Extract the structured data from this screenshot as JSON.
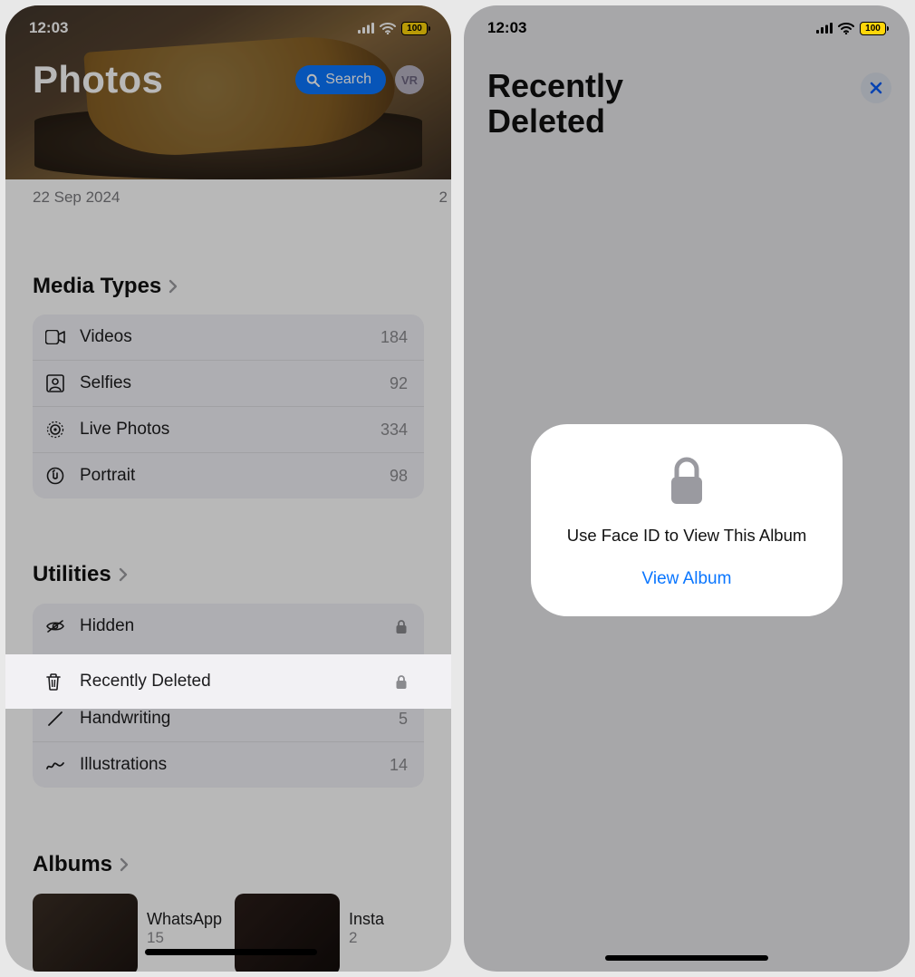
{
  "status": {
    "time": "12:03",
    "battery": "100"
  },
  "left": {
    "title": "Photos",
    "search_label": "Search",
    "avatar": "VR",
    "date": "22 Sep 2024",
    "date_peek": "2",
    "sections": {
      "media_types": "Media Types",
      "utilities": "Utilities",
      "albums": "Albums"
    },
    "media_types": [
      {
        "icon": "video",
        "label": "Videos",
        "count": "184"
      },
      {
        "icon": "selfie",
        "label": "Selfies",
        "count": "92"
      },
      {
        "icon": "live",
        "label": "Live Photos",
        "count": "334"
      },
      {
        "icon": "portrait",
        "label": "Portrait",
        "count": "98"
      }
    ],
    "utilities": [
      {
        "icon": "hidden",
        "label": "Hidden",
        "locked": true
      },
      {
        "icon": "trash",
        "label": "Recently Deleted",
        "locked": true,
        "highlighted": true
      },
      {
        "icon": "handwriting",
        "label": "Handwriting",
        "count": "5"
      },
      {
        "icon": "illustrations",
        "label": "Illustrations",
        "count": "14"
      }
    ],
    "albums": [
      {
        "name": "WhatsApp",
        "count": "15"
      },
      {
        "name": "Insta",
        "count": "2"
      }
    ]
  },
  "right": {
    "title_line1": "Recently",
    "title_line2": "Deleted",
    "modal_text": "Use Face ID to View This Album",
    "view_label": "View Album"
  }
}
